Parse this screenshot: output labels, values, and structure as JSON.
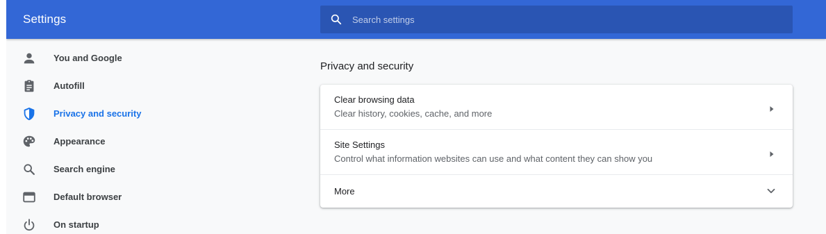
{
  "app": {
    "title": "Settings",
    "colors": {
      "header": "#3367d6",
      "search_bg": "#2a55b3",
      "accent": "#1a73e8",
      "page_bg": "#f8f9fa"
    }
  },
  "search": {
    "placeholder": "Search settings",
    "value": "",
    "icon": "search-icon"
  },
  "sidebar": {
    "items": [
      {
        "label": "You and Google",
        "icon": "person-icon",
        "active": false
      },
      {
        "label": "Autofill",
        "icon": "clipboard-icon",
        "active": false
      },
      {
        "label": "Privacy and security",
        "icon": "shield-icon",
        "active": true
      },
      {
        "label": "Appearance",
        "icon": "palette-icon",
        "active": false
      },
      {
        "label": "Search engine",
        "icon": "search-icon",
        "active": false
      },
      {
        "label": "Default browser",
        "icon": "browser-window-icon",
        "active": false
      },
      {
        "label": "On startup",
        "icon": "power-icon",
        "active": false
      }
    ]
  },
  "main": {
    "section_title": "Privacy and security",
    "rows": [
      {
        "title": "Clear browsing data",
        "subtitle": "Clear history, cookies, cache, and more",
        "icon": "arrow-right-icon"
      },
      {
        "title": "Site Settings",
        "subtitle": "Control what information websites can use and what content they can show you",
        "icon": "arrow-right-icon"
      },
      {
        "title": "More",
        "icon": "chevron-down-icon"
      }
    ]
  }
}
